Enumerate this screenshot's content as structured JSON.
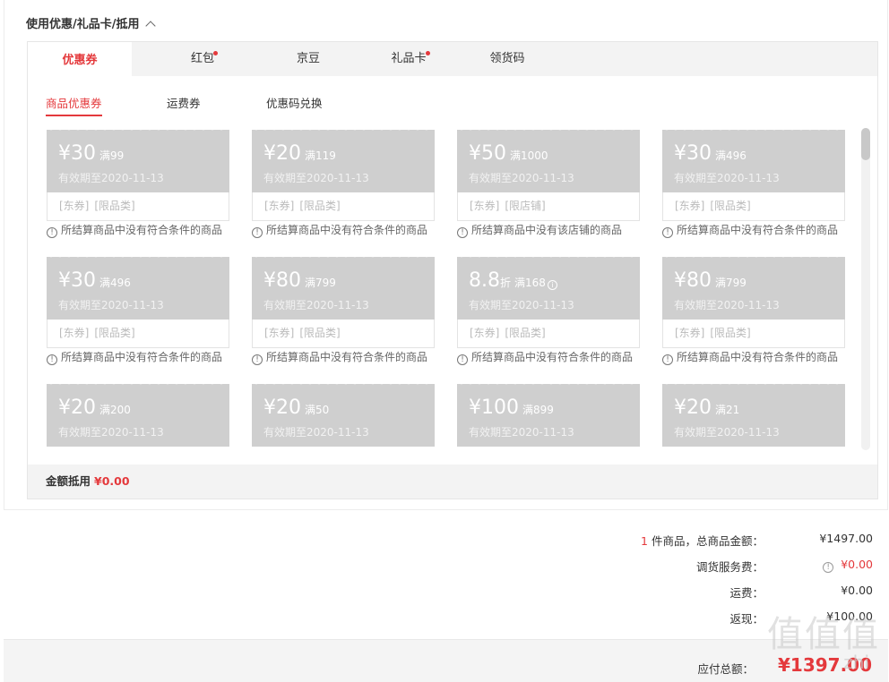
{
  "section": {
    "title": "使用优惠/礼品卡/抵用"
  },
  "tabs": [
    {
      "label": "优惠券",
      "active": true,
      "dot": false
    },
    {
      "label": "红包",
      "active": false,
      "dot": true
    },
    {
      "label": "京豆",
      "active": false,
      "dot": false
    },
    {
      "label": "礼品卡",
      "active": false,
      "dot": true
    },
    {
      "label": "领货码",
      "active": false,
      "dot": false
    }
  ],
  "subtabs": [
    {
      "label": "商品优惠券",
      "active": true
    },
    {
      "label": "运费券",
      "active": false
    },
    {
      "label": "优惠码兑换",
      "active": false
    }
  ],
  "coupons": [
    {
      "amount": "30",
      "prefix": "¥",
      "suffix": "",
      "condition": "满99",
      "valid": "有效期至2020-11-13",
      "tags": [
        "[东券]",
        "[限品类]"
      ],
      "reason": "所结算商品中没有符合条件的商品"
    },
    {
      "amount": "20",
      "prefix": "¥",
      "suffix": "",
      "condition": "满119",
      "valid": "有效期至2020-11-13",
      "tags": [
        "[东券]",
        "[限品类]"
      ],
      "reason": "所结算商品中没有符合条件的商品"
    },
    {
      "amount": "50",
      "prefix": "¥",
      "suffix": "",
      "condition": "满1000",
      "valid": "有效期至2020-11-13",
      "tags": [
        "[东券]",
        "[限店铺]"
      ],
      "reason": "所结算商品中没有该店铺的商品"
    },
    {
      "amount": "30",
      "prefix": "¥",
      "suffix": "",
      "condition": "满496",
      "valid": "有效期至2020-11-13",
      "tags": [
        "[东券]",
        "[限品类]"
      ],
      "reason": "所结算商品中没有符合条件的商品"
    },
    {
      "amount": "30",
      "prefix": "¥",
      "suffix": "",
      "condition": "满496",
      "valid": "有效期至2020-11-13",
      "tags": [
        "[东券]",
        "[限品类]"
      ],
      "reason": "所结算商品中没有符合条件的商品"
    },
    {
      "amount": "80",
      "prefix": "¥",
      "suffix": "",
      "condition": "满799",
      "valid": "有效期至2020-11-13",
      "tags": [
        "[东券]",
        "[限品类]"
      ],
      "reason": "所结算商品中没有符合条件的商品"
    },
    {
      "amount": "8.8",
      "prefix": "",
      "suffix": "折",
      "condition": "满168",
      "valid": "有效期至2020-11-13",
      "tags": [
        "[东券]",
        "[限品类]"
      ],
      "reason": "所结算商品中没有符合条件的商品",
      "info": true
    },
    {
      "amount": "80",
      "prefix": "¥",
      "suffix": "",
      "condition": "满799",
      "valid": "有效期至2020-11-13",
      "tags": [
        "[东券]",
        "[限品类]"
      ],
      "reason": "所结算商品中没有符合条件的商品"
    },
    {
      "amount": "20",
      "prefix": "¥",
      "suffix": "",
      "condition": "满200",
      "valid": "有效期至2020-11-13",
      "tags": [],
      "reason": ""
    },
    {
      "amount": "20",
      "prefix": "¥",
      "suffix": "",
      "condition": "满50",
      "valid": "有效期至2020-11-13",
      "tags": [],
      "reason": ""
    },
    {
      "amount": "100",
      "prefix": "¥",
      "suffix": "",
      "condition": "满899",
      "valid": "有效期至2020-11-13",
      "tags": [],
      "reason": ""
    },
    {
      "amount": "20",
      "prefix": "¥",
      "suffix": "",
      "condition": "满21",
      "valid": "有效期至2020-11-13",
      "tags": [],
      "reason": ""
    }
  ],
  "deduct": {
    "label": "金额抵用",
    "value": "¥0.00"
  },
  "summary": {
    "items_count": "1",
    "items_label": "件商品，总商品金额：",
    "items_value": "¥1497.00",
    "service_label": "调货服务费：",
    "service_value": "¥0.00",
    "shipping_label": "运费：",
    "shipping_value": "¥0.00",
    "cashback_label": "返现：",
    "cashback_value": "¥100.00"
  },
  "footer": {
    "label": "应付总额：",
    "total": "¥1397.00"
  },
  "watermark": {
    "logo": "值",
    "site": "zhi"
  },
  "colors": {
    "accent": "#e4393c",
    "coupon_bg": "#cfcfcf"
  }
}
